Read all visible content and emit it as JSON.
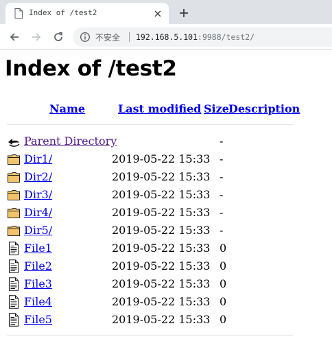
{
  "browser": {
    "tab_title": "Index of /test2",
    "security_label": "不安全",
    "url_host": "192.168.5.101",
    "url_rest": ":9988/test2/"
  },
  "page": {
    "title": "Index of /test2",
    "headers": {
      "name": "Name",
      "last_modified": "Last modified",
      "size": "Size",
      "description": "Description"
    },
    "rows": [
      {
        "name": "Parent Directory",
        "date": "",
        "size": "-",
        "icon": "back-icon"
      },
      {
        "name": "Dir1/",
        "date": "2019-05-22 15:33",
        "size": "-",
        "icon": "folder-icon"
      },
      {
        "name": "Dir2/",
        "date": "2019-05-22 15:33",
        "size": "-",
        "icon": "folder-icon"
      },
      {
        "name": "Dir3/",
        "date": "2019-05-22 15:33",
        "size": "-",
        "icon": "folder-icon"
      },
      {
        "name": "Dir4/",
        "date": "2019-05-22 15:33",
        "size": "-",
        "icon": "folder-icon"
      },
      {
        "name": "Dir5/",
        "date": "2019-05-22 15:33",
        "size": "-",
        "icon": "folder-icon"
      },
      {
        "name": "File1",
        "date": "2019-05-22 15:33",
        "size": "0",
        "icon": "text-file-icon"
      },
      {
        "name": "File2",
        "date": "2019-05-22 15:33",
        "size": "0",
        "icon": "text-file-icon"
      },
      {
        "name": "File3",
        "date": "2019-05-22 15:33",
        "size": "0",
        "icon": "text-file-icon"
      },
      {
        "name": "File4",
        "date": "2019-05-22 15:33",
        "size": "0",
        "icon": "text-file-icon"
      },
      {
        "name": "File5",
        "date": "2019-05-22 15:33",
        "size": "0",
        "icon": "text-file-icon"
      }
    ]
  }
}
